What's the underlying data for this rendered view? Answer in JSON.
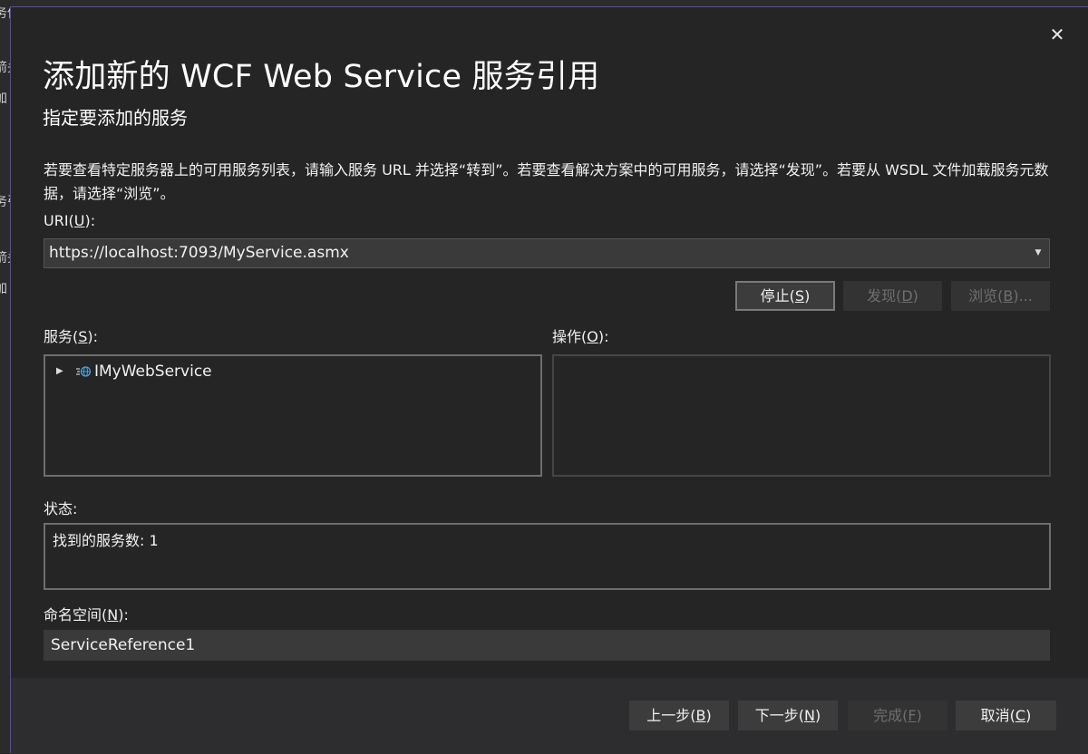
{
  "background": {
    "fragments": [
      "务信",
      "箭头",
      "加",
      "务引",
      "箭头",
      "加"
    ]
  },
  "dialog": {
    "close_label": "✕",
    "title": "添加新的 WCF Web Service 服务引用",
    "subtitle": "指定要添加的服务",
    "description": "若要查看特定服务器上的可用服务列表，请输入服务 URL 并选择“转到”。若要查看解决方案中的可用服务，请选择“发现”。若要从 WSDL 文件加载服务元数据，请选择“浏览”。"
  },
  "uri": {
    "label_prefix": "URI(",
    "label_key": "U",
    "label_suffix": "):",
    "value": "https://localhost:7093/MyService.asmx"
  },
  "actions": {
    "stop": {
      "prefix": "停止(",
      "key": "S",
      "suffix": ")"
    },
    "discover": {
      "prefix": "发现(",
      "key": "D",
      "suffix": ")"
    },
    "browse": {
      "prefix": "浏览(",
      "key": "B",
      "suffix": ")..."
    }
  },
  "services": {
    "label_prefix": "服务(",
    "label_key": "S",
    "label_suffix": "):",
    "items": [
      {
        "name": "IMyWebService",
        "icon": "web-service-icon",
        "expanded": false
      }
    ]
  },
  "operations": {
    "label_prefix": "操作(",
    "label_key": "O",
    "label_suffix": "):"
  },
  "status": {
    "label": "状态:",
    "text": "找到的服务数: 1"
  },
  "namespace": {
    "label_prefix": "命名空间(",
    "label_key": "N",
    "label_suffix": "):",
    "value": "ServiceReference1"
  },
  "footer": {
    "back": {
      "prefix": "上一步(",
      "key": "B",
      "suffix": ")"
    },
    "next": {
      "prefix": "下一步(",
      "key": "N",
      "suffix": ")"
    },
    "finish": {
      "prefix": "完成(",
      "key": "F",
      "suffix": ")"
    },
    "cancel": {
      "prefix": "取消(",
      "key": "C",
      "suffix": ")"
    }
  },
  "colors": {
    "dialog_bg": "#252526",
    "border_accent": "#5a4f8c",
    "button_bg": "#3c3c3c",
    "disabled_text": "#6f6f6f",
    "globe_blue": "#4aa3df"
  }
}
